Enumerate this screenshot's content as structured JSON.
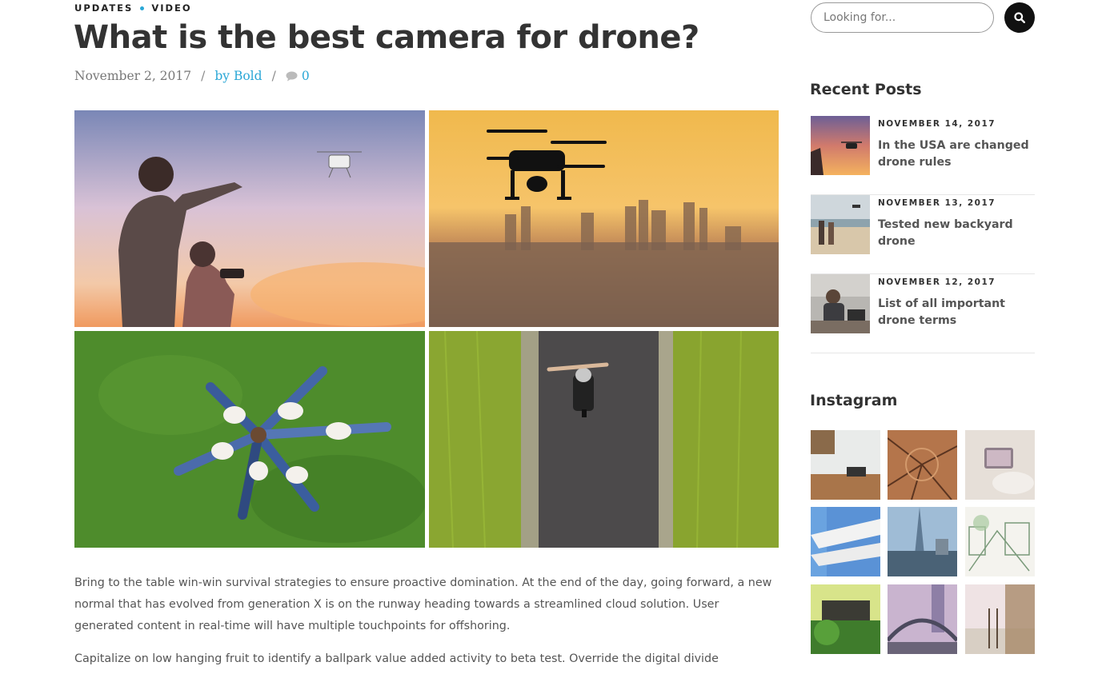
{
  "article": {
    "categories": [
      "UPDATES",
      "VIDEO"
    ],
    "title": "What is the best camera for drone?",
    "date": "November 2, 2017",
    "author": "by Bold",
    "comment_count": "0",
    "paragraphs": [
      "Bring to the table win-win survival strategies to ensure proactive domination. At the end of the day, going forward, a new normal that has evolved from generation X is on the runway heading towards a streamlined cloud solution. User generated content in real-time will have multiple touchpoints for offshoring.",
      "Capitalize on low hanging fruit to identify a ballpark value added activity to beta test. Override the digital divide"
    ]
  },
  "sidebar": {
    "search": {
      "placeholder": "Looking for..."
    },
    "recent_posts_title": "Recent Posts",
    "recent_posts": [
      {
        "date": "NOVEMBER 14, 2017",
        "title": "In the USA are changed drone rules"
      },
      {
        "date": "NOVEMBER 13, 2017",
        "title": "Tested new backyard drone"
      },
      {
        "date": "NOVEMBER 12, 2017",
        "title": "List of all important drone terms"
      }
    ],
    "instagram_title": "Instagram"
  },
  "colors": {
    "accent": "#2aa7d6",
    "heading": "#333333",
    "meta": "#777777"
  },
  "icons": {
    "search": "search-icon",
    "comment": "comment-icon"
  }
}
